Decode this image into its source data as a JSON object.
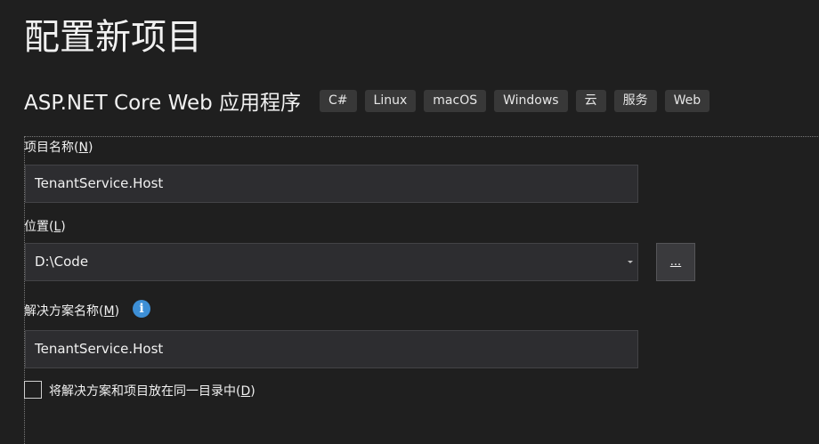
{
  "page": {
    "title": "配置新项目"
  },
  "template": {
    "name": "ASP.NET Core Web 应用程序",
    "tags": [
      "C#",
      "Linux",
      "macOS",
      "Windows",
      "云",
      "服务",
      "Web"
    ]
  },
  "form": {
    "project_name": {
      "label": "项目名称(",
      "accel": "N",
      "label_end": ")",
      "value": "TenantService.Host"
    },
    "location": {
      "label": "位置(",
      "accel": "L",
      "label_end": ")",
      "value": "D:\\Code",
      "browse_label": "..."
    },
    "solution_name": {
      "label": "解决方案名称(",
      "accel": "M",
      "label_end": ")",
      "info_icon": "i",
      "value": "TenantService.Host"
    },
    "same_directory": {
      "label": "将解决方案和项目放在同一目录中(",
      "accel": "D",
      "label_end": ")",
      "checked": false
    }
  },
  "colors": {
    "background": "#1f1f1f",
    "input_background": "#2d2d30",
    "tag_background": "#383838",
    "info_icon": "#3d8fd6"
  }
}
